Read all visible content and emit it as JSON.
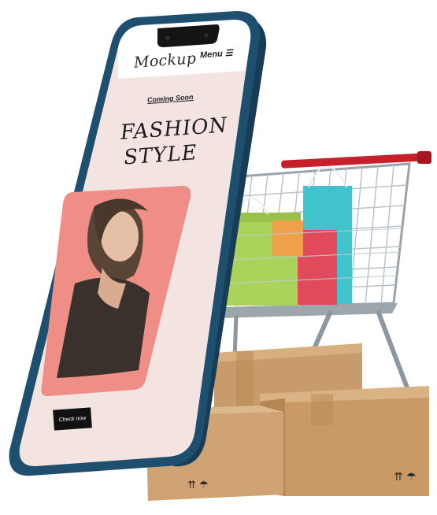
{
  "phone": {
    "brand": "Mockup",
    "menu_label": "Menu ☰",
    "coming_soon": "Coming Soon",
    "headline_line1": "FASHION",
    "headline_line2": "STYLE",
    "cta_label": "Check now"
  },
  "colors": {
    "phone_frame": "#1f4f6e",
    "screen_bg": "#f3e4e2",
    "photo_bg": "#ef8e86",
    "cart_handle": "#c8202a",
    "box": "#c89c6a"
  }
}
